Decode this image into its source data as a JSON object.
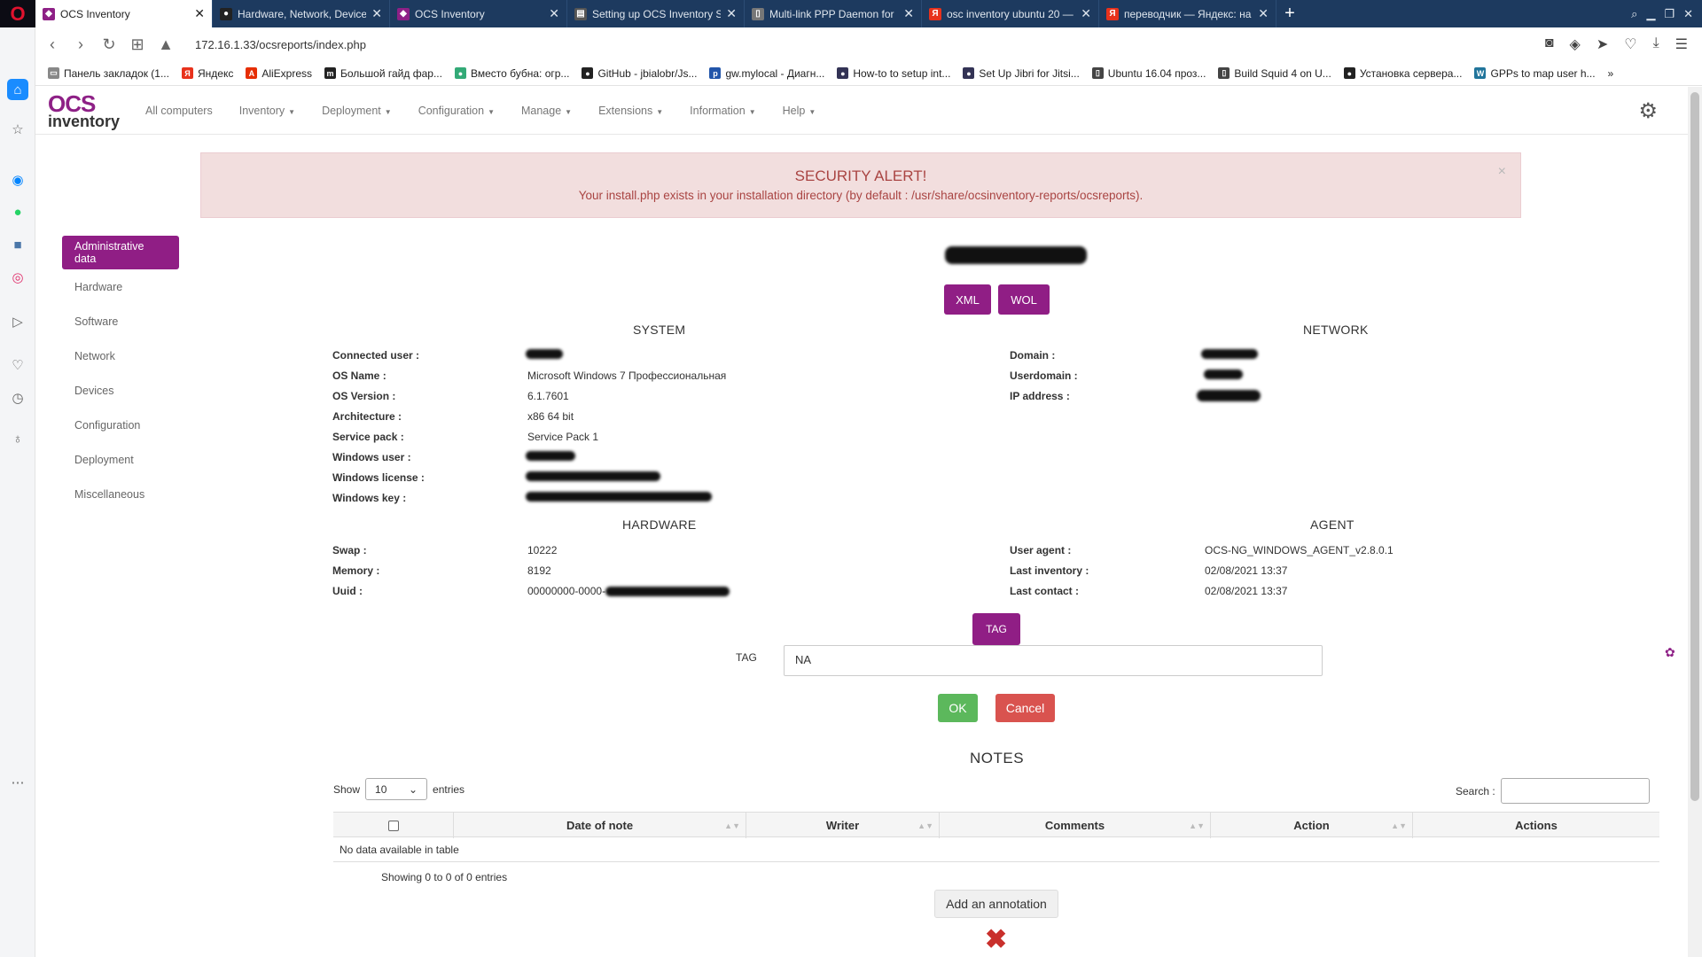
{
  "browser": {
    "tabs": [
      {
        "label": "OCS Inventory",
        "icon": "ocs-icon",
        "active": true
      },
      {
        "label": "Hardware, Network, Device",
        "icon": "github-icon"
      },
      {
        "label": "OCS Inventory",
        "icon": "ocs-icon"
      },
      {
        "label": "Setting up OCS Inventory S",
        "icon": "book-icon"
      },
      {
        "label": "Multi-link PPP Daemon for",
        "icon": "doc-icon"
      },
      {
        "label": "osc inventory ubuntu 20 —",
        "icon": "yandex-icon"
      },
      {
        "label": "переводчик — Яндекс: на",
        "icon": "yandex-icon"
      }
    ],
    "url": "172.16.1.33/ocsreports/index.php",
    "bookmarks": [
      "Панель закладок (1...",
      "Яндекс",
      "AliExpress",
      "Большой гайд фар...",
      "Вместо бубна: огр...",
      "GitHub - jbialobr/Js...",
      "gw.mylocal - Диагн...",
      "How-to to setup int...",
      "Set Up Jibri for Jitsi...",
      "Ubuntu 16.04 проз...",
      "Build Squid 4 on U...",
      "Установка сервера...",
      "GPPs to map user h..."
    ]
  },
  "app": {
    "logo_top": "OCS",
    "logo_bottom": "inventory",
    "menu": [
      {
        "label": "All computers",
        "caret": false
      },
      {
        "label": "Inventory",
        "caret": true
      },
      {
        "label": "Deployment",
        "caret": true
      },
      {
        "label": "Configuration",
        "caret": true
      },
      {
        "label": "Manage",
        "caret": true
      },
      {
        "label": "Extensions",
        "caret": true
      },
      {
        "label": "Information",
        "caret": true
      },
      {
        "label": "Help",
        "caret": true
      }
    ]
  },
  "alert": {
    "title": "SECURITY ALERT!",
    "message": "Your install.php exists in your installation directory (by default : /usr/share/ocsinventory-reports/ocsreports).",
    "close": "×"
  },
  "sidenav": {
    "active": "Administrative data",
    "items": [
      "Hardware",
      "Software",
      "Network",
      "Devices",
      "Configuration",
      "Deployment",
      "Miscellaneous"
    ]
  },
  "buttons": {
    "xml": "XML",
    "wol": "WOL",
    "tag": "TAG",
    "ok": "OK",
    "cancel": "Cancel",
    "add_annotation": "Add an annotation"
  },
  "system": {
    "title": "SYSTEM",
    "rows": [
      {
        "label": "Connected user :",
        "value": ""
      },
      {
        "label": "OS Name :",
        "value": "Microsoft Windows 7 Профессиональная"
      },
      {
        "label": "OS Version :",
        "value": "6.1.7601"
      },
      {
        "label": "Architecture :",
        "value": "x86 64 bit"
      },
      {
        "label": "Service pack :",
        "value": "Service Pack 1"
      },
      {
        "label": "Windows user :",
        "value": ""
      },
      {
        "label": "Windows license :",
        "value": ""
      },
      {
        "label": "Windows key :",
        "value": ""
      }
    ]
  },
  "network": {
    "title": "NETWORK",
    "rows": [
      {
        "label": "Domain :",
        "value": ""
      },
      {
        "label": "Userdomain :",
        "value": ""
      },
      {
        "label": "IP address :",
        "value": ""
      }
    ]
  },
  "hardware": {
    "title": "HARDWARE",
    "rows": [
      {
        "label": "Swap :",
        "value": "10222"
      },
      {
        "label": "Memory :",
        "value": "8192"
      },
      {
        "label": "Uuid :",
        "value": "00000000-0000-"
      }
    ]
  },
  "agent": {
    "title": "AGENT",
    "rows": [
      {
        "label": "User agent :",
        "value": "OCS-NG_WINDOWS_AGENT_v2.8.0.1"
      },
      {
        "label": "Last inventory :",
        "value": "02/08/2021 13:37"
      },
      {
        "label": "Last contact :",
        "value": "02/08/2021 13:37"
      }
    ]
  },
  "tag": {
    "label": "TAG",
    "value": "NA"
  },
  "notes": {
    "title": "NOTES",
    "show_label": "Show",
    "entries_count": "10",
    "entries_label": "entries",
    "search_label": "Search :",
    "columns": [
      "Date of note",
      "Writer",
      "Comments",
      "Action",
      "Actions"
    ],
    "empty": "No data available in table",
    "showing": "Showing 0 to 0 of 0 entries"
  },
  "colors": {
    "brand": "#901e85",
    "ok": "#5cb85c",
    "cancel": "#d9534f",
    "alert_bg": "#f2dede",
    "alert_text": "#a94442"
  }
}
